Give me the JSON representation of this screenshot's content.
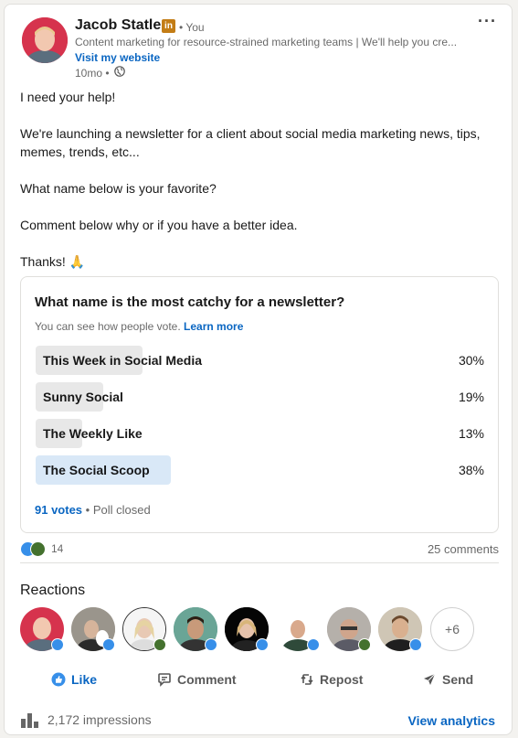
{
  "post": {
    "author": {
      "name": "Jacob Statler",
      "badge": "in",
      "degree": "• You",
      "headline": "Content marketing for resource-strained marketing teams | We'll help you cre...",
      "website_link": "Visit my website",
      "time": "10mo •"
    },
    "more_label": "···",
    "text": {
      "line1": "I need your help!",
      "line2": "We're launching a newsletter for a client about social media marketing news, tips, memes, trends, etc...",
      "line3": "What name below is your favorite?",
      "line4": "Comment below why or if you have a better idea.",
      "line5": "Thanks! 🙏"
    }
  },
  "poll": {
    "question": "What name is the most catchy for a newsletter?",
    "subtext": "You can see how people vote.",
    "learn_more": "Learn more",
    "options": [
      {
        "label": "This Week in Social Media",
        "percent_text": "30%",
        "percent": 30,
        "winner": false
      },
      {
        "label": "Sunny Social",
        "percent_text": "19%",
        "percent": 19,
        "winner": false
      },
      {
        "label": "The Weekly Like",
        "percent_text": "13%",
        "percent": 13,
        "winner": false
      },
      {
        "label": "The Social Scoop",
        "percent_text": "38%",
        "percent": 38,
        "winner": true
      }
    ],
    "votes": "91 votes",
    "status": "• Poll closed"
  },
  "social": {
    "reaction_count": "14",
    "comments": "25 comments"
  },
  "reactions": {
    "title": "Reactions",
    "more": "+6"
  },
  "actions": {
    "like": "Like",
    "comment": "Comment",
    "repost": "Repost",
    "send": "Send"
  },
  "footer": {
    "impressions": "2,172 impressions",
    "analytics": "View analytics"
  },
  "colors": {
    "link": "#0a66c2",
    "winner_bar": "#d9e8f7",
    "bar": "#e8e8e8",
    "like_blue": "#378fe9",
    "celebrate_green": "#44712e"
  }
}
